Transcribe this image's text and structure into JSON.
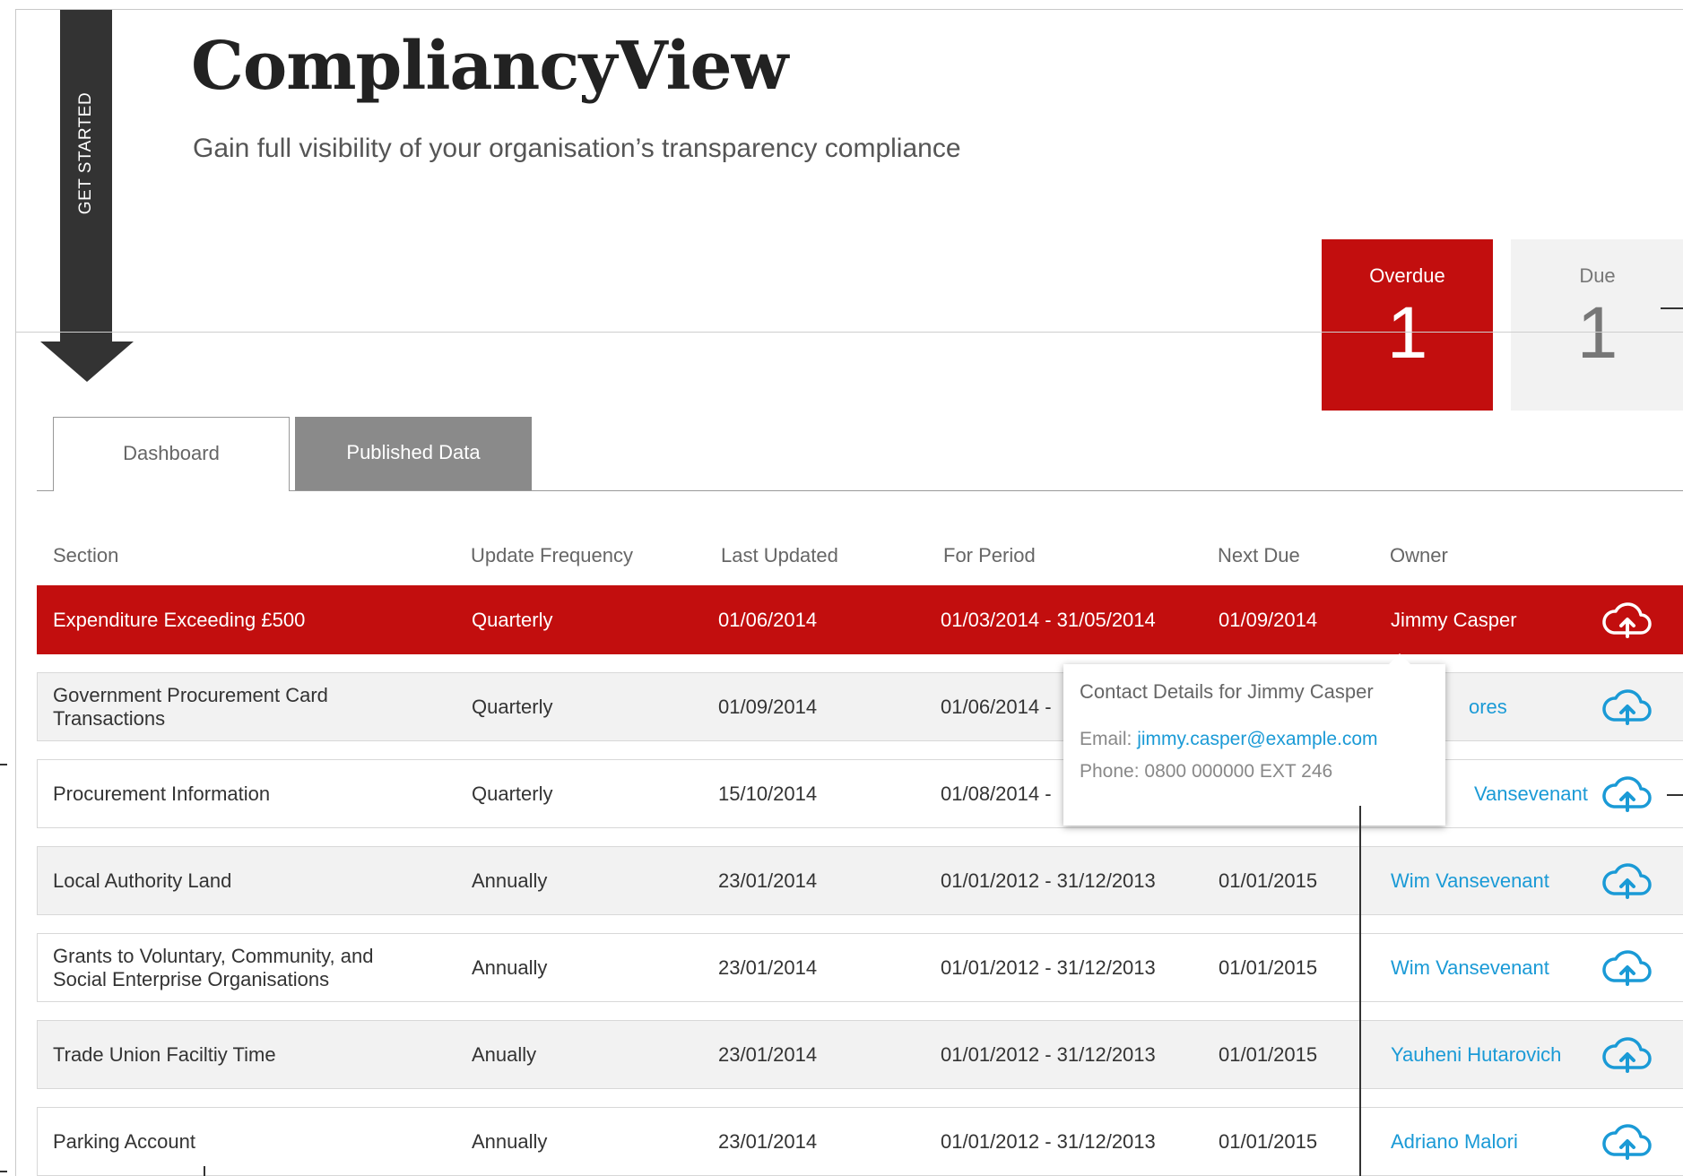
{
  "get_started": {
    "label": "GET STARTED"
  },
  "header": {
    "title": "CompliancyView",
    "subtitle": "Gain full visibility of your organisation’s transparency compliance"
  },
  "status": {
    "overdue": {
      "label": "Overdue",
      "count": "1",
      "color": "#c20e0e"
    },
    "due": {
      "label": "Due",
      "count": "1"
    }
  },
  "tabs": [
    {
      "label": "Dashboard",
      "active": true
    },
    {
      "label": "Published Data",
      "active": false
    }
  ],
  "table": {
    "columns": [
      "Section",
      "Update Frequency",
      "Last Updated",
      "For Period",
      "Next Due",
      "Owner"
    ],
    "rows": [
      {
        "section": "Expenditure Exceeding £500",
        "frequency": "Quarterly",
        "last_updated": "01/06/2014",
        "period": "01/03/2014 - 31/05/2014",
        "next_due": "01/09/2014",
        "owner": "Jimmy Casper",
        "status": "overdue"
      },
      {
        "section": "Government Procurement Card Transactions",
        "frequency": "Quarterly",
        "last_updated": "01/09/2014",
        "period": "01/06/2014 -",
        "next_due": "",
        "owner": "ores"
      },
      {
        "section": "Procurement Information",
        "frequency": "Quarterly",
        "last_updated": "15/10/2014",
        "period": "01/08/2014 -",
        "next_due": "",
        "owner": "Vansevenant"
      },
      {
        "section": "Local Authority Land",
        "frequency": "Annually",
        "last_updated": "23/01/2014",
        "period": "01/01/2012 - 31/12/2013",
        "next_due": "01/01/2015",
        "owner": "Wim Vansevenant"
      },
      {
        "section": "Grants to Voluntary, Community, and Social Enterprise Organisations",
        "frequency": "Annually",
        "last_updated": "23/01/2014",
        "period": "01/01/2012 - 31/12/2013",
        "next_due": "01/01/2015",
        "owner": "Wim Vansevenant"
      },
      {
        "section": "Trade Union Faciltiy Time",
        "frequency": "Anually",
        "last_updated": "23/01/2014",
        "period": "01/01/2012 - 31/12/2013",
        "next_due": "01/01/2015",
        "owner": "Yauheni Hutarovich"
      },
      {
        "section": "Parking Account",
        "frequency": "Annually",
        "last_updated": "23/01/2014",
        "period": "01/01/2012 - 31/12/2013",
        "next_due": "01/01/2015",
        "owner": "Adriano Malori"
      }
    ]
  },
  "tooltip": {
    "title": "Contact Details for Jimmy Casper",
    "email_label": "Email:",
    "email": "jimmy.casper@example.com",
    "phone": "Phone: 0800 000000 EXT 246"
  },
  "icons": {
    "upload": "cloud-upload-icon"
  },
  "colors": {
    "accent_red": "#c20e0e",
    "link_blue": "#1a9ad6"
  }
}
